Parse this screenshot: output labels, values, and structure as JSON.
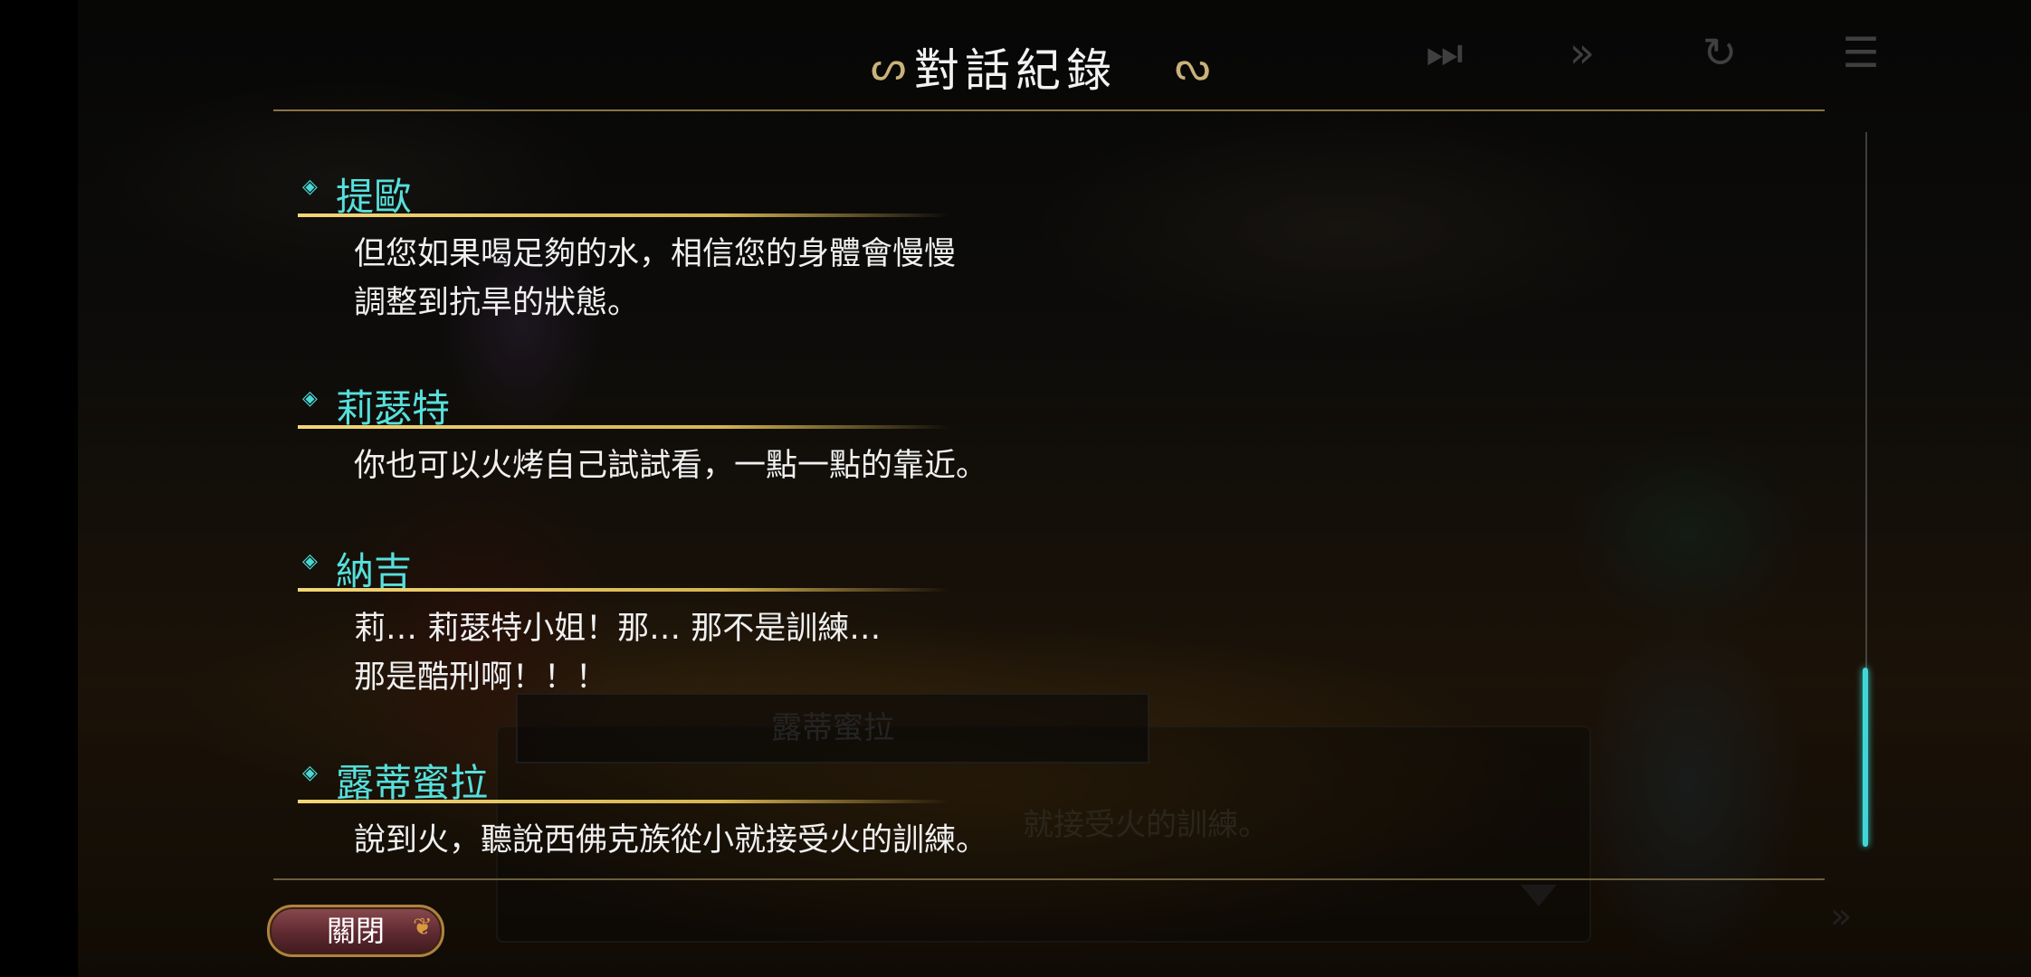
{
  "header": {
    "title": "對話紀錄"
  },
  "controls": {
    "skip_icon": "skip-icon",
    "fast_forward_icon": "fast-forward-icon",
    "auto_icon": "auto-play-icon",
    "log_icon": "log-icon"
  },
  "log": {
    "entries": [
      {
        "speaker": "提歐",
        "text": "但您如果喝足夠的水，相信您的身體會慢慢\n調整到抗旱的狀態。"
      },
      {
        "speaker": "莉瑟特",
        "text": "你也可以火烤自己試試看，一點一點的靠近。"
      },
      {
        "speaker": "納吉",
        "text": "莉… 莉瑟特小姐！那… 那不是訓練…\n那是酷刑啊！！！"
      },
      {
        "speaker": "露蒂蜜拉",
        "text": "說到火，聽說西佛克族從小就接受火的訓練。"
      }
    ]
  },
  "background_dialogue": {
    "speaker": "露蒂蜜拉",
    "visible_text": "就接受火的訓練。"
  },
  "scrollbar": {
    "position_fraction": 1.0
  },
  "close_button": {
    "label": "關閉"
  },
  "colors": {
    "speaker_name": "#56e0dc",
    "speaker_underline": "#f3d676",
    "scroll_thumb": "#41d6d6",
    "close_button": "#6e3338"
  }
}
